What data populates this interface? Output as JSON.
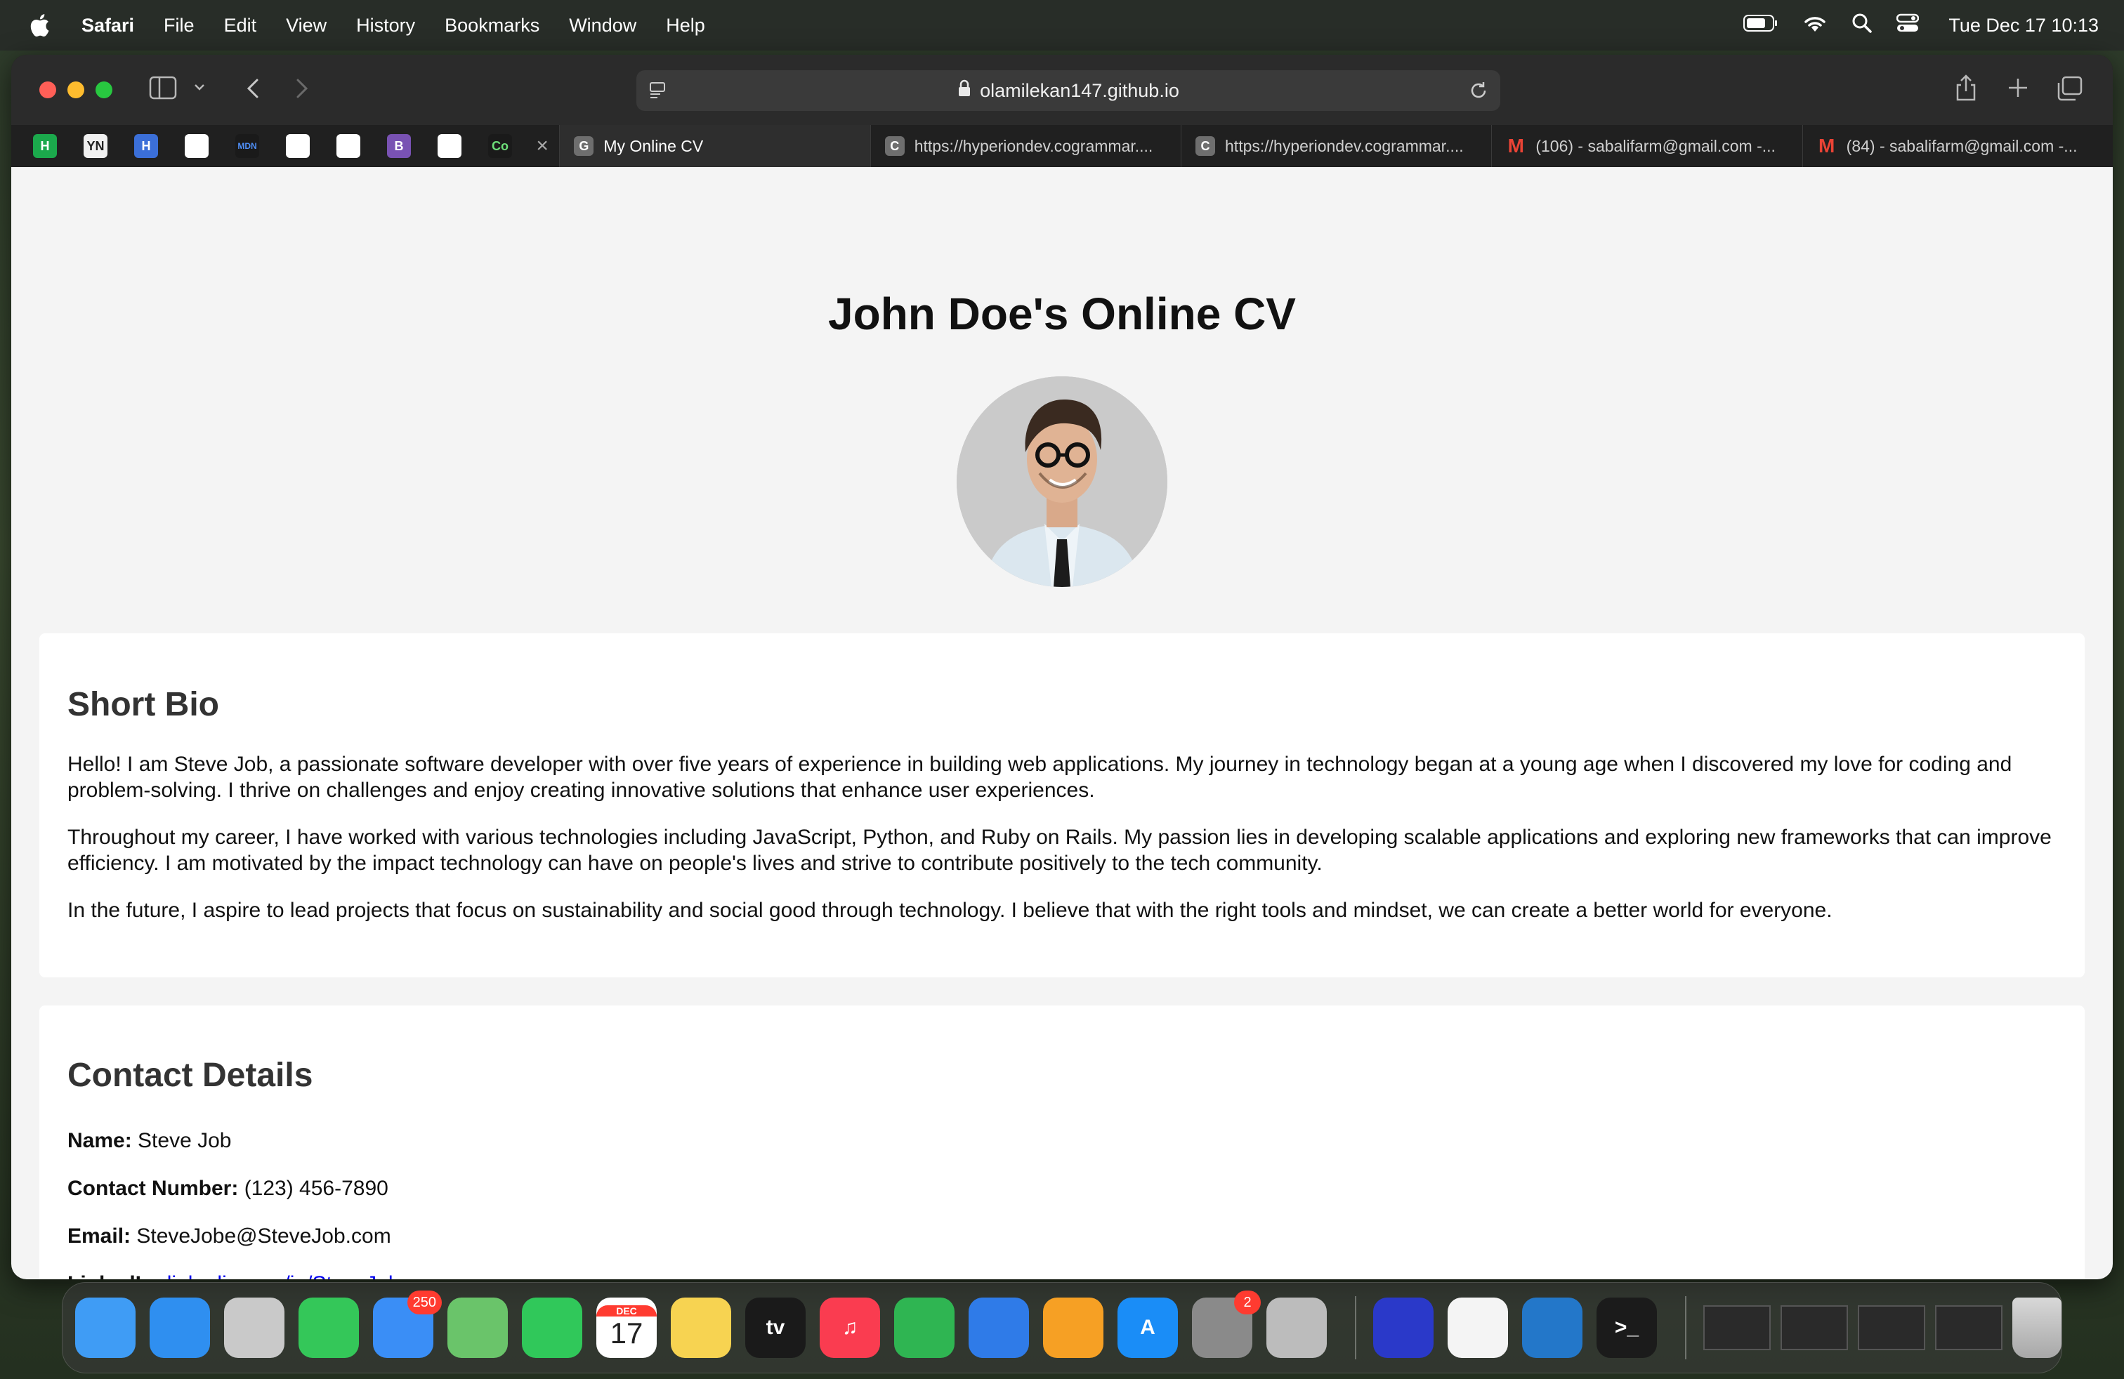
{
  "menubar": {
    "app_name": "Safari",
    "items": [
      "File",
      "Edit",
      "View",
      "History",
      "Bookmarks",
      "Window",
      "Help"
    ],
    "clock": "Tue Dec 17  10:13"
  },
  "toolbar": {
    "url": "olamilekan147.github.io"
  },
  "pinned_tabs": [
    {
      "icon": "hackerrank-icon",
      "label": "H",
      "color": "#1ba94c"
    },
    {
      "icon": "yn-icon",
      "label": "YN",
      "color": "#f0f0f0"
    },
    {
      "icon": "hyperiondev-icon",
      "label": "H",
      "color": "#3b6fd8"
    },
    {
      "icon": "github-icon",
      "label": "",
      "color": "#ffffff"
    },
    {
      "icon": "mdn-icon",
      "label": "MDN",
      "color": "#1a1a1a"
    },
    {
      "icon": "codepen-icon",
      "label": "",
      "color": "#ffffff"
    },
    {
      "icon": "x-tool-icon",
      "label": "",
      "color": "#ffffff"
    },
    {
      "icon": "bootstrap-icon",
      "label": "B",
      "color": "#7952b3"
    },
    {
      "icon": "brackets-icon",
      "label": "",
      "color": "#ffffff"
    },
    {
      "icon": "cogrammar-icon",
      "label": "Co",
      "color": "#1a1a1a"
    }
  ],
  "tabs": [
    {
      "favicon": "G",
      "title": "My Online CV",
      "active": true
    },
    {
      "favicon": "C",
      "title": "https://hyperiondev.cogrammar....",
      "active": false
    },
    {
      "favicon": "C",
      "title": "https://hyperiondev.cogrammar....",
      "active": false
    },
    {
      "favicon": "M",
      "title": "(106) - sabalifarm@gmail.com -...",
      "active": false
    },
    {
      "favicon": "M",
      "title": "(84) - sabalifarm@gmail.com -...",
      "active": false
    }
  ],
  "page": {
    "title": "John Doe's Online CV",
    "bio": {
      "heading": "Short Bio",
      "p1": "Hello! I am Steve Job, a passionate software developer with over five years of experience in building web applications. My journey in technology began at a young age when I discovered my love for coding and problem-solving. I thrive on challenges and enjoy creating innovative solutions that enhance user experiences.",
      "p2": "Throughout my career, I have worked with various technologies including JavaScript, Python, and Ruby on Rails. My passion lies in developing scalable applications and exploring new frameworks that can improve efficiency. I am motivated by the impact technology can have on people's lives and strive to contribute positively to the tech community.",
      "p3": "In the future, I aspire to lead projects that focus on sustainability and social good through technology. I believe that with the right tools and mindset, we can create a better world for everyone."
    },
    "contact": {
      "heading": "Contact Details",
      "name_label": "Name:",
      "name_value": "Steve Job",
      "phone_label": "Contact Number:",
      "phone_value": "(123) 456-7890",
      "email_label": "Email:",
      "email_value": "SteveJobe@SteveJob.com",
      "linkedin_label": "LinkedIn:",
      "linkedin_value": "linkedin.com/in/SteveJob"
    }
  },
  "dock": {
    "apps": [
      {
        "name": "finder-icon",
        "color": "#3f9cf5",
        "label": ""
      },
      {
        "name": "safari-icon",
        "color": "#2f8ff0",
        "label": ""
      },
      {
        "name": "launchpad-icon",
        "color": "#c9c9c9",
        "label": ""
      },
      {
        "name": "messages-icon",
        "color": "#34c759",
        "label": ""
      },
      {
        "name": "mail-icon",
        "color": "#3a8ef6",
        "label": "",
        "badge": "250"
      },
      {
        "name": "maps-icon",
        "color": "#6ac46a",
        "label": ""
      },
      {
        "name": "facetime-icon",
        "color": "#30c85a",
        "label": ""
      },
      {
        "name": "calendar-icon",
        "color": "#ffffff",
        "label": "17",
        "sublabel": "DEC"
      },
      {
        "name": "notes-icon",
        "color": "#f7d351",
        "label": ""
      },
      {
        "name": "apple-tv-icon",
        "color": "#1a1a1a",
        "label": "tv"
      },
      {
        "name": "music-icon",
        "color": "#fa3c50",
        "label": "♫"
      },
      {
        "name": "numbers-icon",
        "color": "#2fb552",
        "label": ""
      },
      {
        "name": "keynote-icon",
        "color": "#2f7be8",
        "label": ""
      },
      {
        "name": "pages-icon",
        "color": "#f6a024",
        "label": ""
      },
      {
        "name": "app-store-icon",
        "color": "#1a8df7",
        "label": "A"
      },
      {
        "name": "system-settings-icon",
        "color": "#8a8a8a",
        "label": "",
        "badge": "2"
      },
      {
        "name": "iphone-mirroring-icon",
        "color": "#bcbcbc",
        "label": ""
      },
      {
        "name": "screens-icon",
        "color": "#2a39c9",
        "label": ""
      },
      {
        "name": "textedit-icon",
        "color": "#f4f4f4",
        "label": ""
      },
      {
        "name": "vscode-icon",
        "color": "#2377c9",
        "label": ""
      },
      {
        "name": "terminal-icon",
        "color": "#1b1b1b",
        "label": ">_"
      }
    ]
  }
}
